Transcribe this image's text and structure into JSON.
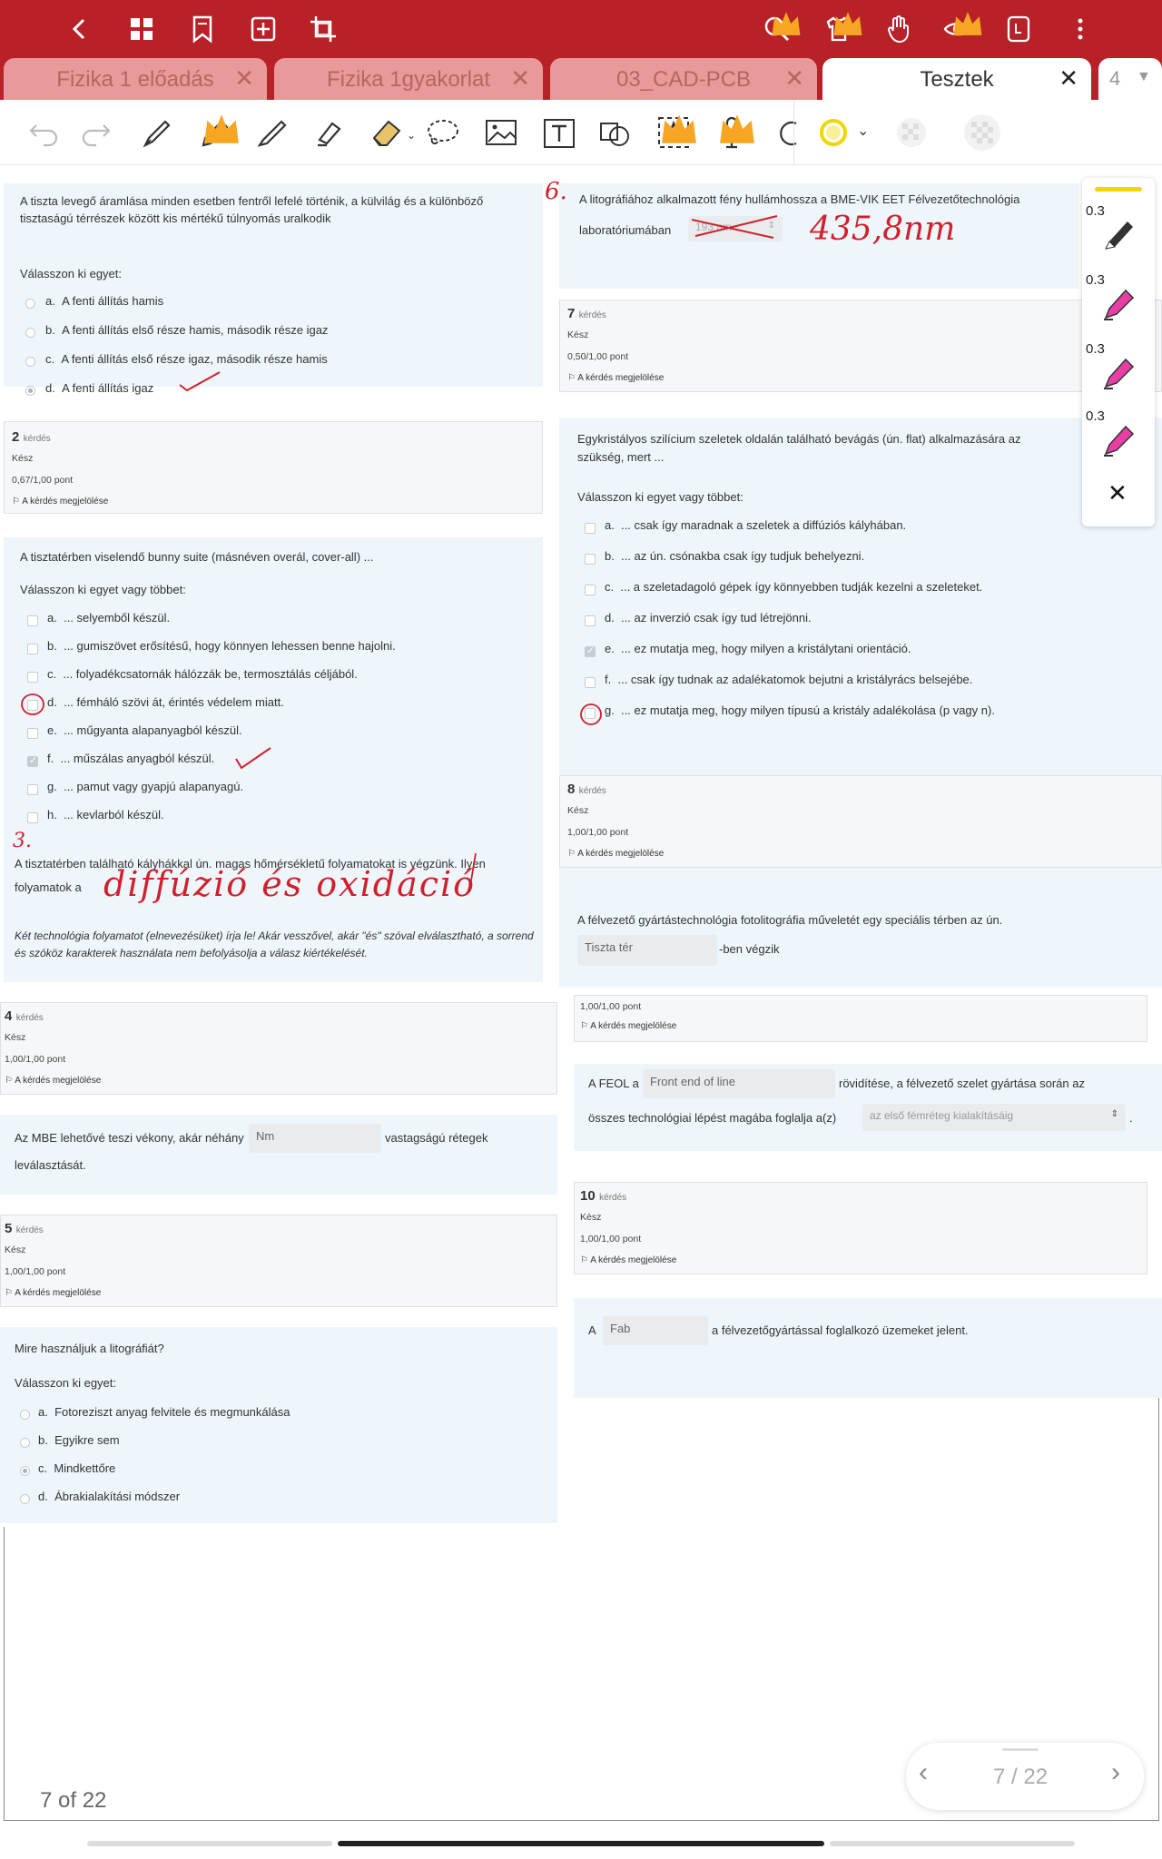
{
  "app": {
    "tabs": [
      {
        "label": "Fizika 1 előadás",
        "active": false
      },
      {
        "label": "Fizika 1gyakorlat",
        "active": false
      },
      {
        "label": "03_CAD-PCB",
        "active": false
      },
      {
        "label": "Tesztek",
        "active": true
      }
    ],
    "tab_count": "4",
    "colors": {
      "brand": "#b82127",
      "card": "#eef5fb",
      "ink": "#d0202b"
    }
  },
  "side_panel": {
    "sizes": [
      "0.3",
      "0.3",
      "0.3",
      "0.3"
    ]
  },
  "q1": {
    "text": "A tiszta levegő áramlása minden esetben fentről lefelé történik, a külvilág és a különböző tisztaságú térrészek között kis mértékű túlnyomás uralkodik",
    "prompt": "Válasszon ki egyet:",
    "options": [
      {
        "letter": "a.",
        "text": "A fenti állítás hamis"
      },
      {
        "letter": "b.",
        "text": "A fenti állítás első része hamis, második része igaz"
      },
      {
        "letter": "c.",
        "text": "A fenti állítás első része igaz, második része hamis"
      },
      {
        "letter": "d.",
        "text": "A fenti állítás igaz"
      }
    ]
  },
  "info2": {
    "num": "2",
    "label": "kérdés",
    "status": "Kész",
    "score": "0,67/1,00 pont",
    "flag": "A kérdés megjelölése"
  },
  "q2": {
    "text": "A tisztatérben viselendő bunny suite (másnéven overál, cover-all) ...",
    "prompt": "Válasszon ki egyet vagy többet:",
    "options": [
      {
        "letter": "a.",
        "text": "... selyemből készül."
      },
      {
        "letter": "b.",
        "text": "... gumiszövet erősítésű, hogy könnyen lehessen benne hajolni."
      },
      {
        "letter": "c.",
        "text": "... folyadékcsatornák hálózzák be, termosztálás céljából."
      },
      {
        "letter": "d.",
        "text": "... fémháló szövi át, érintés védelem miatt."
      },
      {
        "letter": "e.",
        "text": "... műgyanta alapanyagból készül."
      },
      {
        "letter": "f.",
        "text": "... műszálas anyagból készül."
      },
      {
        "letter": "g.",
        "text": "... pamut vagy gyapjú alapanyagú."
      },
      {
        "letter": "h.",
        "text": "... kevlarból készül."
      }
    ]
  },
  "q3": {
    "text": "A tisztatérben található kályhákkal ún. magas hőmérsékletű folyamatokat is végzünk. Ilyen",
    "text2": "folyamatok a",
    "note": "Két technológia folyamatot (elnevezésüket) írja le! Akár vesszővel, akár \"és\" szóval elválasztható, a sorrend és szóköz karakterek használata nem befolyásolja a válasz kiértékelését.",
    "handwriting": "diffúzió és oxidáció",
    "mark": "3."
  },
  "info4": {
    "num": "4",
    "label": "kérdés",
    "status": "Kész",
    "score": "1,00/1,00 pont",
    "flag": "A kérdés megjelölése"
  },
  "q4": {
    "text_before": "Az MBE lehetővé teszi vékony, akár néhány",
    "field": "Nm",
    "text_after": "vastagságú rétegek",
    "text_line2": "leválasztását."
  },
  "info5": {
    "num": "5",
    "label": "kérdés",
    "status": "Kész",
    "score": "1,00/1,00 pont",
    "flag": "A kérdés megjelölése"
  },
  "q5": {
    "text": "Mire használjuk a litográfiát?",
    "prompt": "Válasszon ki egyet:",
    "options": [
      {
        "letter": "a.",
        "text": "Fotoreziszt anyag felvitele és megmunkálása"
      },
      {
        "letter": "b.",
        "text": "Egyikre sem"
      },
      {
        "letter": "c.",
        "text": "Mindkettőre"
      },
      {
        "letter": "d.",
        "text": "Ábrakialakítási módszer"
      }
    ]
  },
  "q6": {
    "mark": "6.",
    "text": "A litográfiához alkalmazott fény hullámhossza a BME-VIK EET Félvezetőtechnológia",
    "text2": "laboratóriumában",
    "select": "193 nm",
    "handwriting": "435,8nm"
  },
  "info7": {
    "num": "7",
    "label": "kérdés",
    "status": "Kész",
    "score": "0,50/1,00 pont",
    "flag": "A kérdés megjelölése"
  },
  "q7": {
    "text": "Egykristályos szilícium szeletek oldalán található bevágás (ún. flat) alkalmazására az",
    "text2": "szükség, mert ...",
    "prompt": "Válasszon ki egyet vagy többet:",
    "options": [
      {
        "letter": "a.",
        "text": "... csak így maradnak a szeletek a diffúziós kályhában."
      },
      {
        "letter": "b.",
        "text": "... az ún. csónakba csak így tudjuk behelyezni."
      },
      {
        "letter": "c.",
        "text": "... a szeletadagoló gépek így könnyebben tudják kezelni a szeleteket."
      },
      {
        "letter": "d.",
        "text": "... az inverzió csak így tud létrejönni."
      },
      {
        "letter": "e.",
        "text": "... ez mutatja meg, hogy milyen a kristálytani orientáció."
      },
      {
        "letter": "f.",
        "text": "... csak így tudnak az adalékatomok bejutni a kristályrács belsejébe."
      },
      {
        "letter": "g.",
        "text": "... ez mutatja meg, hogy milyen típusú a kristály adalékolása (p vagy n)."
      }
    ]
  },
  "info8": {
    "num": "8",
    "label": "kérdés",
    "status": "Kész",
    "score": "1,00/1,00 pont",
    "flag": "A kérdés megjelölése"
  },
  "q8": {
    "text": "A félvezető gyártástechnológia fotolitográfia műveletét egy speciális térben az ún.",
    "field": "Tiszta tér",
    "text_after": "-ben végzik"
  },
  "info9": {
    "score": "1,00/1,00 pont",
    "flag": "A kérdés megjelölése"
  },
  "q9": {
    "text_before": "A FEOL a",
    "field": "Front end of line",
    "text_after": "rövidítése, a félvezető szelet gyártása során az",
    "text_line2": "összes technológiai lépést magába foglalja a(z)",
    "select": "az első fémréteg kialakításáig",
    "end": "."
  },
  "info10": {
    "num": "10",
    "label": "kérdés",
    "status": "Kész",
    "score": "1,00/1,00 pont",
    "flag": "A kérdés megjelölése"
  },
  "q10": {
    "text_before": "A",
    "field": "Fab",
    "text_after": "a félvezetőgyártással foglalkozó üzemeket jelent."
  },
  "footer": {
    "page_label": "7 of 22",
    "pager": "7 / 22"
  }
}
